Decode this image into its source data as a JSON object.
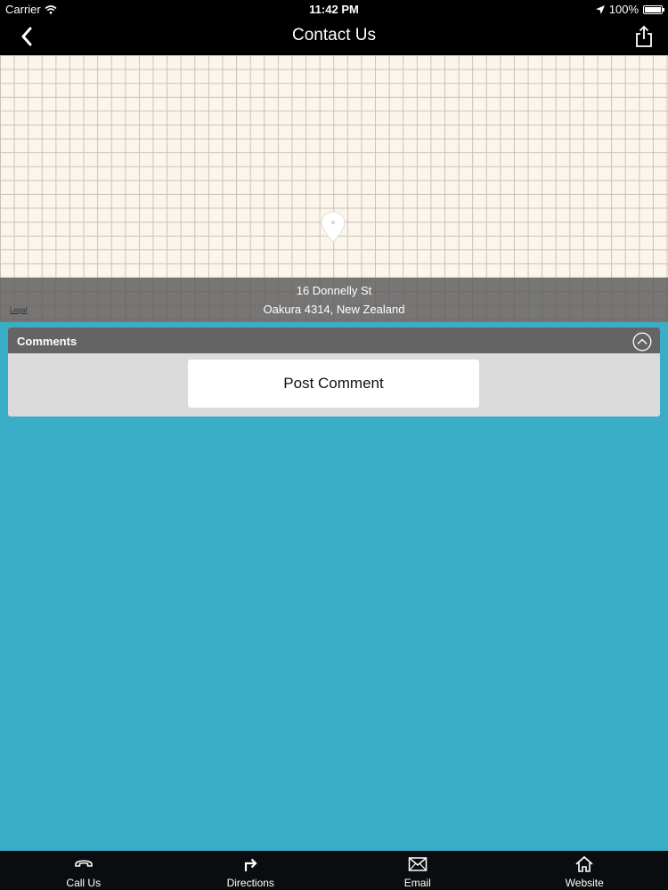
{
  "status_bar": {
    "carrier": "Carrier",
    "time": "11:42 PM",
    "battery": "100%",
    "battery_level": 1.0
  },
  "nav": {
    "title": "Contact Us"
  },
  "map": {
    "address_line1": "16 Donnelly St",
    "address_line2": "Oakura 4314, New Zealand",
    "legal": "Legal"
  },
  "comments": {
    "header": "Comments",
    "post_button": "Post Comment"
  },
  "tabs": [
    {
      "label": "Call Us",
      "icon": "phone-icon"
    },
    {
      "label": "Directions",
      "icon": "directions-icon"
    },
    {
      "label": "Email",
      "icon": "email-icon"
    },
    {
      "label": "Website",
      "icon": "home-icon"
    }
  ],
  "colors": {
    "background": "#3aaec6",
    "bar": "#000000",
    "comments_header": "#646464",
    "comments_body": "#dcdbdc"
  }
}
